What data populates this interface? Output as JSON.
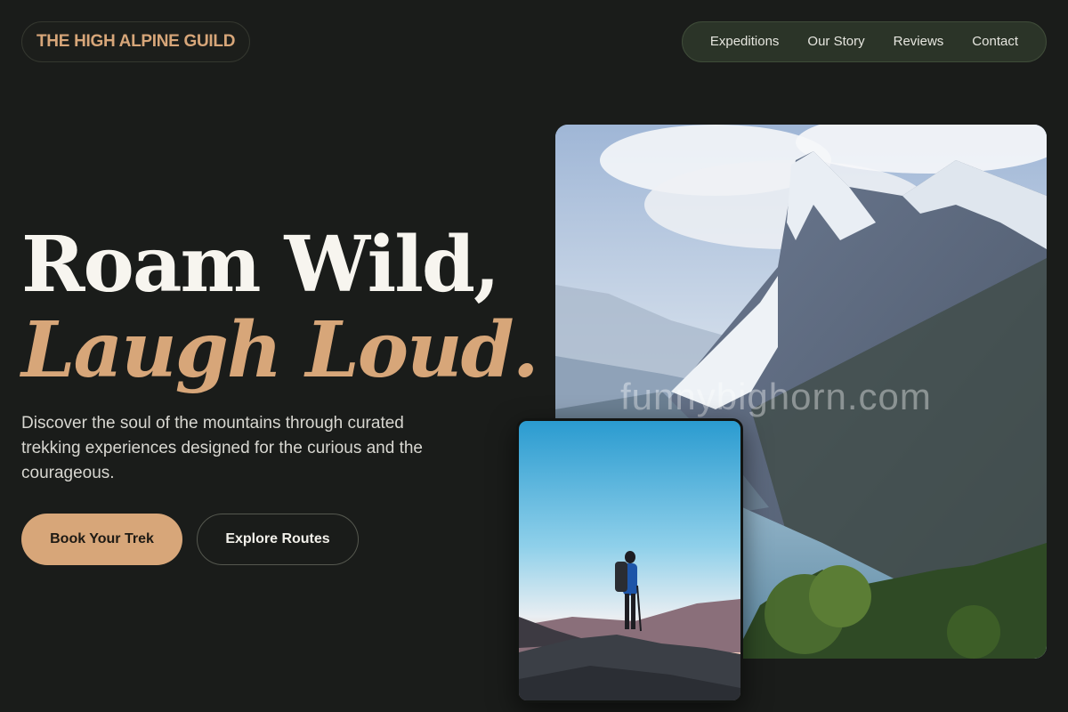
{
  "brand": {
    "name": "THE HIGH ALPINE GUILD"
  },
  "nav": {
    "items": [
      "Expeditions",
      "Our Story",
      "Reviews",
      "Contact"
    ]
  },
  "hero": {
    "title_line1": "Roam Wild,",
    "title_line2": "Laugh Loud.",
    "description": "Discover the soul of the mountains through curated trekking experiences designed for the curious and the courageous.",
    "primary_cta": "Book Your Trek",
    "secondary_cta": "Explore Routes"
  },
  "images": {
    "main": "mountain-lake-photo",
    "secondary": "hiker-at-sunset-photo"
  },
  "watermark": "funnybighorn.com",
  "colors": {
    "background": "#1a1c1a",
    "accent": "#d7a679",
    "nav_bg": "#2b3428"
  }
}
